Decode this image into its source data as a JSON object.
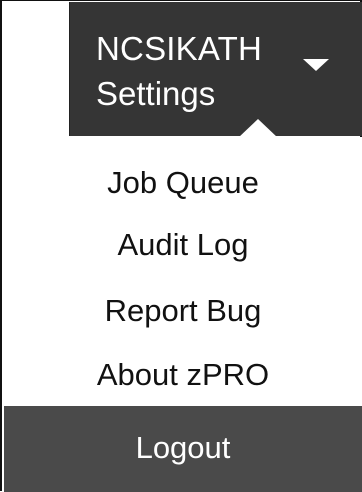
{
  "header": {
    "user_name": "NCSIKATH",
    "subtitle": "Settings",
    "caret_icon": "caret-down-icon"
  },
  "menu": {
    "items": [
      {
        "label": "Job Queue"
      },
      {
        "label": "Audit Log"
      },
      {
        "label": "Report Bug"
      },
      {
        "label": "About zPRO"
      }
    ],
    "logout_label": "Logout"
  },
  "colors": {
    "header_bg": "#353535",
    "logout_bg": "#4a4a4a",
    "text_light": "#ffffff",
    "text_dark": "#111111"
  }
}
